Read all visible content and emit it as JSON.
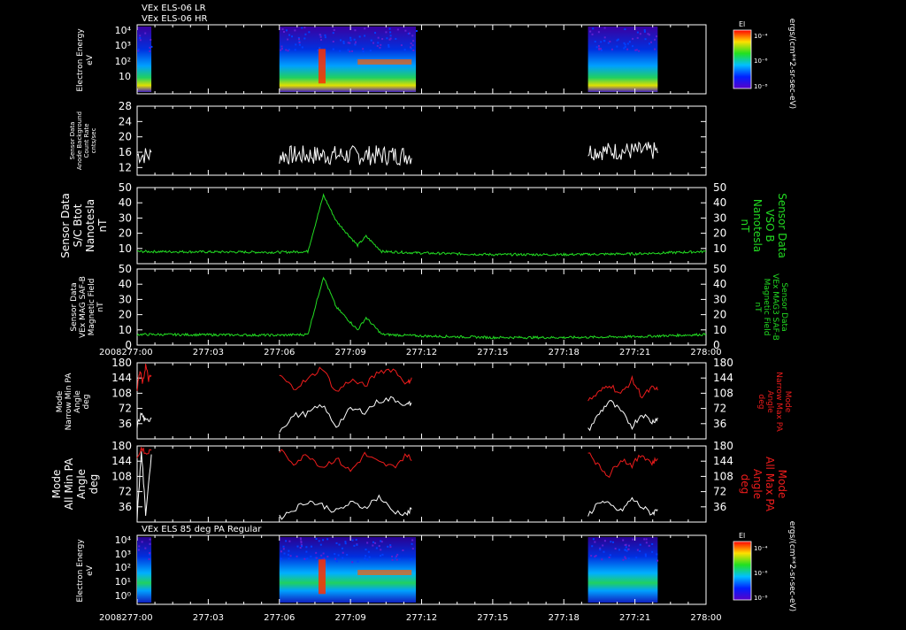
{
  "header": {
    "line1": "VEx ELS-06 LR",
    "line2": "VEx ELS-06 HR"
  },
  "year_label": "2008",
  "time_ticks": [
    "277:00",
    "277:03",
    "277:06",
    "277:09",
    "277:12",
    "277:15",
    "277:18",
    "277:21",
    "278:00"
  ],
  "colorbar": {
    "label": "El",
    "ticks": [
      "10⁻⁴",
      "10⁻⁶",
      "10⁻⁸"
    ],
    "units": "ergs/(cm**2-sr-sec-eV)"
  },
  "colors": {
    "white": "#ffffff",
    "green": "#22dd22",
    "red": "#ee1c1c"
  },
  "chart_data": [
    {
      "id": "p1",
      "type": "heatmap",
      "subtitle": "",
      "ylabel": [
        "Electron Energy",
        "eV"
      ],
      "yticks": [
        "10⁴",
        "10³",
        "10²",
        "10"
      ],
      "segments": [
        [
          0,
          0.1
        ],
        [
          1.0,
          1.96
        ],
        [
          3.17,
          3.66
        ]
      ]
    },
    {
      "id": "p2",
      "type": "line",
      "ylabel": [
        "Sensor Data",
        "Anode Background",
        "Count Rate",
        "cnts/sec"
      ],
      "ylim": [
        10,
        28
      ],
      "yticks": [
        12,
        16,
        20,
        24,
        28
      ],
      "series": [
        {
          "color": "white",
          "x": [
            0,
            0.1
          ],
          "mean": 15.2,
          "amp": 1.2
        },
        {
          "color": "white",
          "x": [
            1.0,
            1.93
          ],
          "mean": 15.2,
          "amp": 1.3
        },
        {
          "color": "white",
          "x": [
            3.17,
            3.66
          ],
          "mean": 16.3,
          "amp": 1.2
        }
      ]
    },
    {
      "id": "p3",
      "type": "line",
      "ylabel": [
        "Sensor Data",
        "S/C Btot",
        "Nanotesla",
        "nT"
      ],
      "ylabel_right": [
        "Sensor Data",
        "VSO B",
        "Nanotesla",
        "nT"
      ],
      "ylim": [
        0,
        50
      ],
      "yticks": [
        10,
        20,
        30,
        40,
        50
      ],
      "series": [
        {
          "color": "green",
          "x": [
            0.0,
            1.0,
            1.2,
            1.31,
            1.4,
            1.55,
            1.61,
            1.72,
            2.0,
            2.5,
            3.0,
            3.5,
            4.0
          ],
          "y": [
            8,
            7.5,
            8,
            45,
            28,
            12,
            18,
            8,
            7,
            6,
            6,
            6.5,
            8
          ]
        }
      ]
    },
    {
      "id": "p4",
      "type": "line",
      "ylabel": [
        "Sensor Data",
        "VEx MAG SAF-B",
        "Magnetic Field",
        "nT"
      ],
      "ylabel_right": [
        "Sensor Data",
        "VEx MAG3 SAF-B",
        "Magnetic Field",
        "nT"
      ],
      "ylim": [
        0,
        50
      ],
      "yticks": [
        0,
        10,
        20,
        30,
        40,
        50
      ],
      "series": [
        {
          "color": "green",
          "x": [
            0.0,
            1.0,
            1.2,
            1.31,
            1.4,
            1.55,
            1.61,
            1.72,
            2.0,
            2.5,
            3.0,
            3.5,
            4.0
          ],
          "y": [
            7,
            6.5,
            7,
            45,
            25,
            10,
            18,
            7,
            6,
            5,
            5,
            5.5,
            7
          ]
        }
      ]
    },
    {
      "id": "p5",
      "type": "line",
      "ylabel": [
        "Mode",
        "Narrow Min PA",
        "Angle",
        "deg"
      ],
      "ylabel_right": [
        "Mode",
        "Narrow Max PA",
        "Angle",
        "deg"
      ],
      "ylim": [
        0,
        180
      ],
      "yticks": [
        36,
        72,
        108,
        144,
        180
      ],
      "series": [
        {
          "color": "red",
          "segments": [
            {
              "x": [
                0.0,
                0.02,
                0.04,
                0.06,
                0.08,
                0.1
              ],
              "y": [
                120,
                160,
                130,
                175,
                140,
                150
              ]
            },
            {
              "x": [
                1.0,
                1.1,
                1.2,
                1.3,
                1.4,
                1.5,
                1.6,
                1.7,
                1.8,
                1.9,
                1.93
              ],
              "y": [
                150,
                120,
                140,
                170,
                110,
                140,
                125,
                160,
                165,
                130,
                145
              ]
            },
            {
              "x": [
                3.17,
                3.25,
                3.32,
                3.4,
                3.48,
                3.55,
                3.62,
                3.66
              ],
              "y": [
                90,
                110,
                130,
                105,
                140,
                100,
                120,
                115
              ]
            }
          ]
        },
        {
          "color": "white",
          "segments": [
            {
              "x": [
                0.0,
                0.03,
                0.06,
                0.1
              ],
              "y": [
                30,
                60,
                40,
                50
              ]
            },
            {
              "x": [
                1.0,
                1.1,
                1.2,
                1.3,
                1.4,
                1.5,
                1.6,
                1.7,
                1.8,
                1.9,
                1.93
              ],
              "y": [
                20,
                55,
                60,
                80,
                30,
                70,
                65,
                90,
                95,
                80,
                85
              ]
            },
            {
              "x": [
                3.17,
                3.25,
                3.32,
                3.4,
                3.48,
                3.55,
                3.62,
                3.66
              ],
              "y": [
                20,
                60,
                90,
                65,
                30,
                60,
                40,
                50
              ]
            }
          ]
        }
      ]
    },
    {
      "id": "p6",
      "type": "line",
      "ylabel": [
        "Mode",
        "All Min PA",
        "Angle",
        "deg"
      ],
      "ylabel_right": [
        "Mode",
        "All Max PA",
        "Angle",
        "deg"
      ],
      "ylim": [
        0,
        180
      ],
      "yticks": [
        36,
        72,
        108,
        144,
        180
      ],
      "series": [
        {
          "color": "red",
          "segments": [
            {
              "x": [
                0.0,
                0.03,
                0.06,
                0.1
              ],
              "y": [
                150,
                175,
                160,
                170
              ]
            },
            {
              "x": [
                1.0,
                1.1,
                1.2,
                1.3,
                1.4,
                1.5,
                1.6,
                1.7,
                1.8,
                1.9,
                1.93
              ],
              "y": [
                170,
                140,
                160,
                130,
                150,
                120,
                160,
                140,
                130,
                160,
                145
              ]
            },
            {
              "x": [
                3.17,
                3.25,
                3.32,
                3.4,
                3.48,
                3.55,
                3.62,
                3.66
              ],
              "y": [
                170,
                130,
                110,
                150,
                135,
                160,
                140,
                150
              ]
            }
          ]
        },
        {
          "color": "white",
          "segments": [
            {
              "x": [
                0.0,
                0.03,
                0.06,
                0.1
              ],
              "y": [
                10,
                170,
                20,
                160
              ]
            },
            {
              "x": [
                1.0,
                1.1,
                1.2,
                1.3,
                1.4,
                1.5,
                1.6,
                1.7,
                1.8,
                1.9,
                1.93
              ],
              "y": [
                10,
                30,
                50,
                40,
                25,
                45,
                35,
                60,
                25,
                20,
                30
              ]
            },
            {
              "x": [
                3.17,
                3.25,
                3.32,
                3.4,
                3.48,
                3.55,
                3.62,
                3.66
              ],
              "y": [
                15,
                50,
                40,
                25,
                55,
                35,
                20,
                30
              ]
            }
          ]
        }
      ]
    },
    {
      "id": "p7",
      "type": "heatmap",
      "subtitle": "VEx ELS 85 deg PA Regular",
      "ylabel": [
        "Electron Energy",
        "eV"
      ],
      "yticks": [
        "10⁴",
        "10³",
        "10²",
        "10¹",
        "10⁰"
      ],
      "segments": [
        [
          0,
          0.1
        ],
        [
          1.0,
          1.96
        ],
        [
          3.17,
          3.66
        ]
      ]
    }
  ]
}
